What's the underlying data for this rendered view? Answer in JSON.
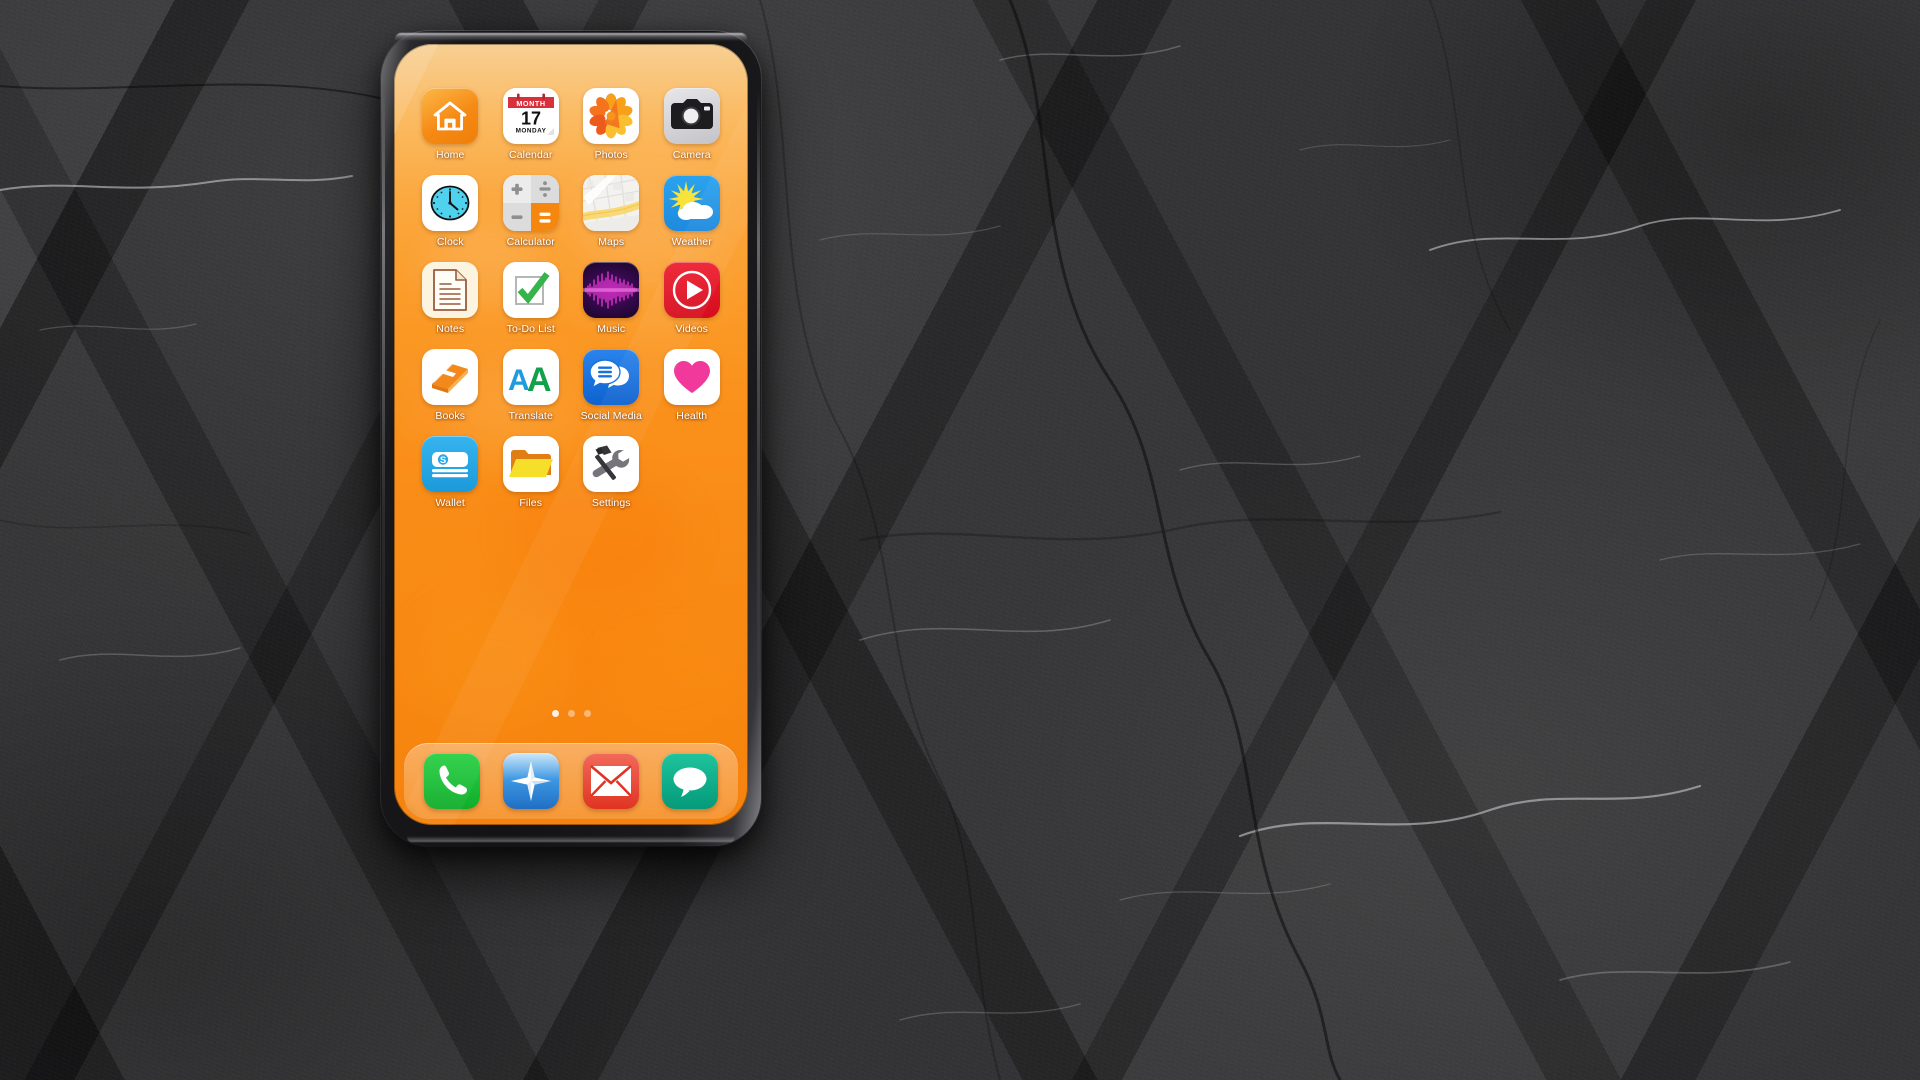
{
  "scene": {
    "description": "Smartphone home screen mockup on dark slate stone surface",
    "surface_color": "#2d2d2f",
    "device_frame_color": "#18181a"
  },
  "wallpaper": {
    "name": "orange-watercolor-gradient",
    "top_color": "#f7cf93",
    "bottom_color": "#f5820c"
  },
  "home_screen": {
    "apps": [
      {
        "label": "Home",
        "icon": "house-icon",
        "bg": "#f79a2a",
        "tile": "gradient-orange"
      },
      {
        "label": "Calendar",
        "icon": "calendar-icon",
        "bg": "#ffffff",
        "month_label": "MONTH",
        "day_number": "17",
        "weekday": "MONDAY",
        "header_color": "#d8313c"
      },
      {
        "label": "Photos",
        "icon": "flower-photos-icon",
        "bg": "#ffffff",
        "petal_colors": [
          "#f97c1c",
          "#fbb033",
          "#f2611c",
          "#fdd23a"
        ]
      },
      {
        "label": "Camera",
        "icon": "camera-icon",
        "bg": "#cfcfd2",
        "body_color": "#1d1d1f"
      },
      {
        "label": "Clock",
        "icon": "clock-icon",
        "bg": "#ffffff",
        "face_color": "#4fd2ee"
      },
      {
        "label": "Calculator",
        "icon": "calculator-icon",
        "bg": "#e8e8e8",
        "accent": "#f5870f",
        "symbols": [
          "+",
          "÷",
          "−",
          "="
        ]
      },
      {
        "label": "Maps",
        "icon": "map-icon",
        "bg": "#f4f2ef",
        "road_color": "#f7cf4a"
      },
      {
        "label": "Weather",
        "icon": "sun-cloud-icon",
        "bg": "#2196e8",
        "sun_color": "#f7e33b",
        "cloud_color": "#ffffff"
      },
      {
        "label": "Notes",
        "icon": "note-page-icon",
        "bg": "#fdf4e0",
        "line_color": "#9c5a3c"
      },
      {
        "label": "To-Do List",
        "icon": "checkmark-box-icon",
        "bg": "#ffffff",
        "check_color": "#36b34a"
      },
      {
        "label": "Music",
        "icon": "waveform-icon",
        "bg": "#2b0b3a",
        "wave_color": "#ee2ad2"
      },
      {
        "label": "Videos",
        "icon": "play-circle-icon",
        "bg": "#e51627",
        "glyph_color": "#ffffff"
      },
      {
        "label": "Books",
        "icon": "book-icon",
        "bg": "#ffffff",
        "book_color": "#f2891a"
      },
      {
        "label": "Translate",
        "icon": "letters-aa-icon",
        "bg": "#ffffff",
        "letter_colors": [
          "#1e9ae0",
          "#12a04a"
        ]
      },
      {
        "label": "Social Media",
        "icon": "chat-bubbles-icon",
        "bg": "#1573e0",
        "bubble_color": "#ffffff"
      },
      {
        "label": "Health",
        "icon": "heart-icon",
        "bg": "#ffffff",
        "heart_color": "#f0399b"
      },
      {
        "label": "Wallet",
        "icon": "money-stack-icon",
        "bg": "#2aa8e8",
        "note_color": "#ffffff"
      },
      {
        "label": "Files",
        "icon": "folder-icon",
        "bg": "#ffffff",
        "folder_back": "#e07d14",
        "folder_front": "#f5df2a"
      },
      {
        "label": "Settings",
        "icon": "tools-icon",
        "bg": "#ffffff",
        "hammer_color": "#2c2c30",
        "wrench_color": "#6e6e74"
      }
    ],
    "page_dots": {
      "total": 3,
      "active_index": 0
    }
  },
  "dock": {
    "apps": [
      {
        "label": "Phone",
        "icon": "phone-handset-icon",
        "bg": "#1fbf39"
      },
      {
        "label": "Browser",
        "icon": "compass-icon",
        "bg": "#4ba6e8"
      },
      {
        "label": "Mail",
        "icon": "envelope-icon",
        "bg": "#ea4a3a"
      },
      {
        "label": "Messages",
        "icon": "speech-bubble-icon",
        "bg": "#11b08c"
      }
    ]
  }
}
